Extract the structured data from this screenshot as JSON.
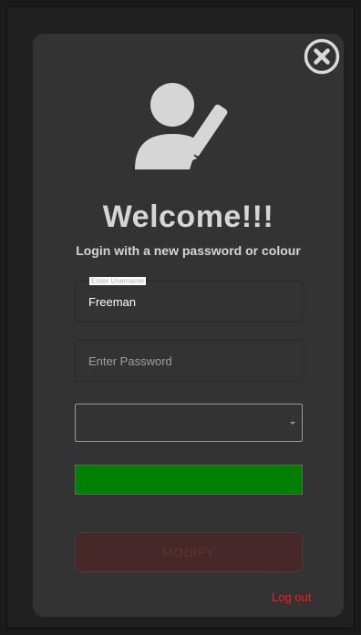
{
  "header": {
    "title": "Welcome!!!",
    "subtitle": "Login with a new password or colour"
  },
  "icons": {
    "close": "close-icon",
    "avatar": "user-edit-icon"
  },
  "form": {
    "username": {
      "label": "Enter Username",
      "value": "Freeman"
    },
    "password": {
      "placeholder": "Enter Password",
      "value": ""
    },
    "colour_select": {
      "selected": ""
    },
    "colour_swatch": {
      "color": "#008000"
    },
    "modify_label": "MODIFY"
  },
  "footer": {
    "logout_label": "Log out"
  },
  "colors": {
    "background": "#333333",
    "text": "#d6d6d6",
    "logout": "#ff1a1a",
    "modify_button": "#462828"
  }
}
